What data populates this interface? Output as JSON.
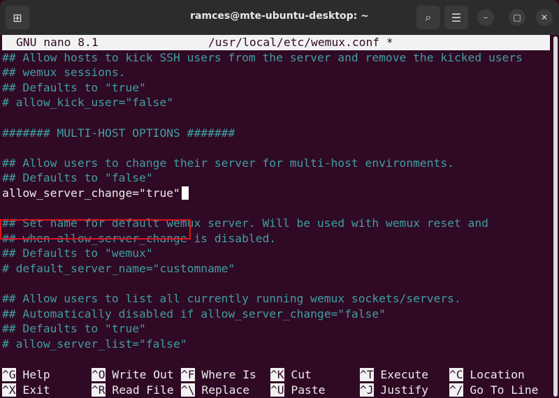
{
  "window": {
    "title": "ramces@mte-ubuntu-desktop: ~",
    "new_tab_icon": "new-tab-icon",
    "search_icon": "search-icon",
    "menu_icon": "hamburger-icon"
  },
  "nano": {
    "version": "GNU nano 8.1",
    "filename": "/usr/local/etc/wemux.conf *"
  },
  "lines": [
    {
      "text": "## Allow hosts to kick SSH users from the server and remove the kicked users",
      "type": "comment"
    },
    {
      "text": "## wemux sessions.",
      "type": "comment"
    },
    {
      "text": "## Defaults to \"true\"",
      "type": "comment"
    },
    {
      "text": "# allow_kick_user=\"false\"",
      "type": "comment"
    },
    {
      "text": "",
      "type": "comment"
    },
    {
      "text": "####### MULTI-HOST OPTIONS #######",
      "type": "comment"
    },
    {
      "text": "",
      "type": "comment"
    },
    {
      "text": "## Allow users to change their server for multi-host environments.",
      "type": "comment"
    },
    {
      "text": "## Defaults to \"false\"",
      "type": "comment"
    },
    {
      "text": "allow_server_change=\"true\"",
      "type": "plain"
    },
    {
      "text": "",
      "type": "comment"
    },
    {
      "text": "## Set name for default wemux server. Will be used with wemux reset and",
      "type": "comment"
    },
    {
      "text": "## when allow_server_change is disabled.",
      "type": "comment"
    },
    {
      "text": "## Defaults to \"wemux\"",
      "type": "comment"
    },
    {
      "text": "# default_server_name=\"customname\"",
      "type": "comment"
    },
    {
      "text": "",
      "type": "comment"
    },
    {
      "text": "## Allow users to list all currently running wemux sockets/servers.",
      "type": "comment"
    },
    {
      "text": "## Automatically disabled if allow_server_change=\"false\"",
      "type": "comment"
    },
    {
      "text": "## Defaults to \"true\"",
      "type": "comment"
    },
    {
      "text": "# allow_server_list=\"false\"",
      "type": "comment"
    }
  ],
  "shortcuts": [
    [
      {
        "key": "^G",
        "label": "Help"
      },
      {
        "key": "^O",
        "label": "Write Out"
      },
      {
        "key": "^F",
        "label": "Where Is"
      },
      {
        "key": "^K",
        "label": "Cut"
      },
      {
        "key": "^T",
        "label": "Execute"
      },
      {
        "key": "^C",
        "label": "Location"
      }
    ],
    [
      {
        "key": "^X",
        "label": "Exit"
      },
      {
        "key": "^R",
        "label": "Read File"
      },
      {
        "key": "^\\",
        "label": "Replace"
      },
      {
        "key": "^U",
        "label": "Paste"
      },
      {
        "key": "^J",
        "label": "Justify"
      },
      {
        "key": "^/",
        "label": "Go To Line"
      }
    ]
  ]
}
